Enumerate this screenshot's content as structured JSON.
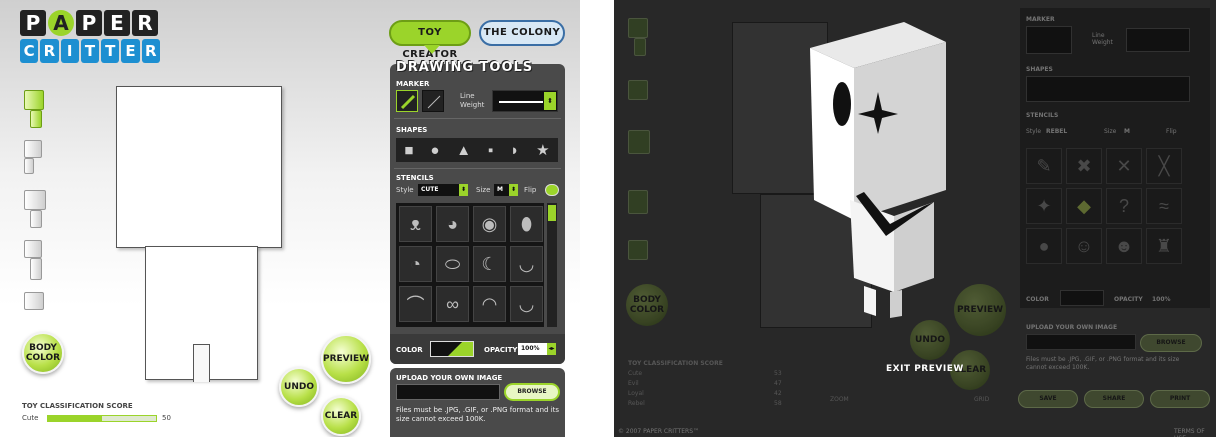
{
  "logo": {
    "line1": [
      "P",
      "A",
      "P",
      "E",
      "R"
    ],
    "line2": [
      "C",
      "R",
      "I",
      "T",
      "T",
      "E",
      "R",
      "S"
    ]
  },
  "tabs": {
    "toy_creator": "TOY CREATOR",
    "the_colony": "THE COLONY"
  },
  "tools": {
    "title": "DRAWING TOOLS",
    "marker_label": "MARKER",
    "line_weight_label": "Line Weight",
    "shapes_label": "SHAPES",
    "stencils_label": "STENCILS",
    "style_label": "Style",
    "style_value": "CUTE",
    "size_label": "Size",
    "size_value": "M",
    "flip_label": "Flip",
    "color_label": "COLOR",
    "opacity_label": "OPACITY",
    "opacity_value": "100%"
  },
  "upload": {
    "title": "UPLOAD YOUR OWN IMAGE",
    "browse": "BROWSE",
    "note": "Files must be .JPG, .GIF, or .PNG format and its size cannot exceed 100K."
  },
  "buttons": {
    "body_color": "BODY COLOR",
    "preview": "PREVIEW",
    "undo": "UNDO",
    "clear": "CLEAR",
    "exit_preview": "EXIT PREVIEW"
  },
  "score": {
    "title": "TOY CLASSIFICATION SCORE",
    "rows": [
      {
        "label": "Cute",
        "value": 50,
        "fill": 0.5
      }
    ]
  },
  "preview_view": {
    "marker_label": "MARKER",
    "line_weight_label": "Line Weight",
    "shapes_label": "SHAPES",
    "stencils_label": "STENCILS",
    "style_label": "Style",
    "style_value": "REBEL",
    "size_label": "Size",
    "size_value": "M",
    "flip_label": "Flip",
    "color_label": "COLOR",
    "opacity_label": "OPACITY",
    "opacity_value": "100%",
    "upload_title": "UPLOAD YOUR OWN IMAGE",
    "browse": "BROWSE",
    "upload_note": "Files must be .JPG, .GIF, or .PNG format and its size cannot exceed 100K.",
    "score_title": "TOY CLASSIFICATION SCORE",
    "scores": [
      {
        "label": "Cute",
        "value": 53,
        "fill": 0.53
      },
      {
        "label": "Evil",
        "value": 47,
        "fill": 0.47
      },
      {
        "label": "Loyal",
        "value": 42,
        "fill": 0.42
      },
      {
        "label": "Rebel",
        "value": 58,
        "fill": 0.58
      }
    ],
    "zoom_label": "ZOOM",
    "grid_label": "GRID",
    "save": "SAVE",
    "share": "SHARE",
    "print": "PRINT",
    "footer_left": "© 2007 PAPER CRITTERS™",
    "footer_right": "TERMS OF USE"
  },
  "colors": {
    "accent_green": "#9bd42a",
    "tab_blue": "#3a6ea5",
    "panel_dark": "#4a4a4a"
  }
}
